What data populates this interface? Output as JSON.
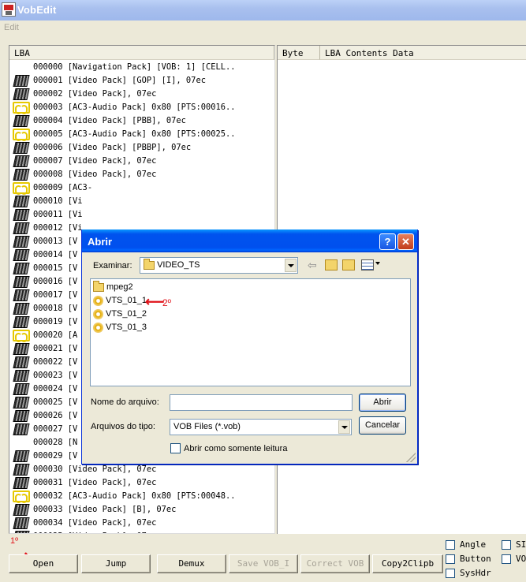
{
  "app": {
    "title": "VobEdit",
    "menu": [
      "Edit"
    ]
  },
  "list": {
    "header": "LBA",
    "rows": [
      {
        "icon": "none",
        "text": "000000 [Navigation Pack] [VOB: 1] [CELL.."
      },
      {
        "icon": "video",
        "text": "000001 [Video Pack] [GOP] [I], 07ec"
      },
      {
        "icon": "video",
        "text": "000002 [Video Pack], 07ec"
      },
      {
        "icon": "audio",
        "text": "000003 [AC3-Audio Pack] 0x80 [PTS:00016.."
      },
      {
        "icon": "video",
        "text": "000004 [Video Pack] [PBB], 07ec"
      },
      {
        "icon": "audio",
        "text": "000005 [AC3-Audio Pack] 0x80 [PTS:00025.."
      },
      {
        "icon": "video",
        "text": "000006 [Video Pack] [PBBP], 07ec"
      },
      {
        "icon": "video",
        "text": "000007 [Video Pack], 07ec"
      },
      {
        "icon": "video",
        "text": "000008 [Video Pack], 07ec"
      },
      {
        "icon": "audio",
        "text": "000009 [AC3-"
      },
      {
        "icon": "video",
        "text": "000010 [Vi"
      },
      {
        "icon": "video",
        "text": "000011 [Vi"
      },
      {
        "icon": "video",
        "text": "000012 [Vi"
      },
      {
        "icon": "video",
        "text": "000013 [V"
      },
      {
        "icon": "video",
        "text": "000014 [V"
      },
      {
        "icon": "video",
        "text": "000015 [V"
      },
      {
        "icon": "video",
        "text": "000016 [V"
      },
      {
        "icon": "video",
        "text": "000017 [V"
      },
      {
        "icon": "video",
        "text": "000018 [V"
      },
      {
        "icon": "video",
        "text": "000019 [V"
      },
      {
        "icon": "audio",
        "text": "000020 [A"
      },
      {
        "icon": "video",
        "text": "000021 [V"
      },
      {
        "icon": "video",
        "text": "000022 [V"
      },
      {
        "icon": "video",
        "text": "000023 [V"
      },
      {
        "icon": "video",
        "text": "000024 [V"
      },
      {
        "icon": "video",
        "text": "000025 [V"
      },
      {
        "icon": "video",
        "text": "000026 [V"
      },
      {
        "icon": "video",
        "text": "000027 [V"
      },
      {
        "icon": "none",
        "text": "000028 [N"
      },
      {
        "icon": "video",
        "text": "000029 [V"
      },
      {
        "icon": "video",
        "text": "000030 [Video Pack], 07ec"
      },
      {
        "icon": "video",
        "text": "000031 [Video Pack], 07ec"
      },
      {
        "icon": "audio",
        "text": "000032 [AC3-Audio Pack] 0x80 [PTS:00048.."
      },
      {
        "icon": "video",
        "text": "000033 [Video Pack] [B], 07ec"
      },
      {
        "icon": "video",
        "text": "000034 [Video Pack], 07ec"
      },
      {
        "icon": "video",
        "text": "000035 [Video Pack], 07ec"
      }
    ]
  },
  "detail": {
    "header_byte": "Byte",
    "header_contents": "LBA Contents Data"
  },
  "toolbar": {
    "annotation": "1º",
    "buttons": [
      {
        "label": "Open",
        "enabled": true
      },
      {
        "label": "Jump",
        "enabled": true
      },
      {
        "label": "Demux",
        "enabled": true
      },
      {
        "label": "Save VOB_I",
        "enabled": false
      },
      {
        "label": "Correct VOB",
        "enabled": false
      },
      {
        "label": "Copy2Clipb",
        "enabled": true
      }
    ],
    "checkboxes": [
      "Angle",
      "Button",
      "SysHdr",
      "SI",
      "VO"
    ]
  },
  "dialog": {
    "title": "Abrir",
    "look_in_label": "Examinar:",
    "look_in_value": "VIDEO_TS",
    "items": [
      {
        "type": "folder",
        "name": "mpeg2"
      },
      {
        "type": "vob",
        "name": "VTS_01_1"
      },
      {
        "type": "vob",
        "name": "VTS_01_2"
      },
      {
        "type": "vob",
        "name": "VTS_01_3"
      }
    ],
    "annotation": "2º",
    "filename_label": "Nome do arquivo:",
    "filename_value": "",
    "filetype_label": "Arquivos do tipo:",
    "filetype_value": "VOB Files (*.vob)",
    "readonly_label": "Abrir como somente leitura",
    "open_button": "Abrir",
    "cancel_button": "Cancelar",
    "help_glyph": "?",
    "close_glyph": "✕"
  },
  "colors": {
    "annotation": "#e0141b",
    "dialog_title": "#0053ee",
    "audio_icon": "#e6c800"
  }
}
